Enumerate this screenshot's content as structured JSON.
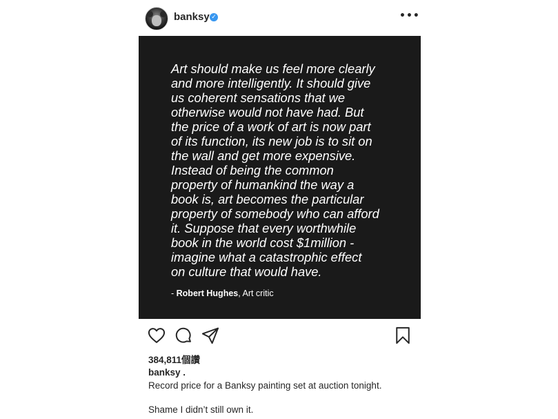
{
  "header": {
    "username": "banksy",
    "verified_icon": "✓",
    "more_icon": "•••"
  },
  "post": {
    "quote_lines": [
      "Art should make us feel more clearly",
      "and more intelligently. It should give",
      "us coherent sensations that we",
      "otherwise would not have had. But",
      "the price of a work of art is now part",
      "of its function, its new job is to sit on",
      "the wall and get more expensive.",
      "Instead of being the common",
      "property of humankind the way a",
      "book is, art becomes the particular",
      "property of somebody who can afford",
      "it. Suppose that every worthwhile",
      "book in the world cost $1million -",
      "imagine what a catastrophic effect",
      "on culture that would have."
    ],
    "attribution_prefix": "- ",
    "attribution_name": "Robert Hughes",
    "attribution_role": ", Art critic",
    "background_color": "#1a1a1a"
  },
  "actions": {
    "icons": [
      "heart-icon",
      "comment-icon",
      "share-icon",
      "bookmark-icon"
    ]
  },
  "likes": "384,811個讚",
  "caption": {
    "username": "banksy",
    "suffix": " .",
    "line1": "Record price for a Banksy painting set at auction tonight.",
    "line2": "Shame I didn’t still own it."
  }
}
